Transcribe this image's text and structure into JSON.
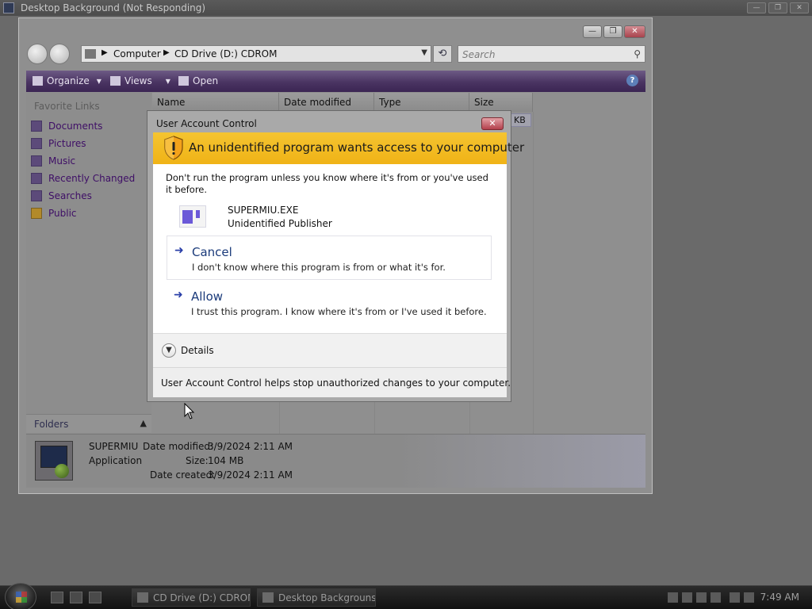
{
  "hung_window": {
    "title": "Desktop Background (Not Responding)",
    "buttons": [
      "—",
      "❐",
      "✕"
    ]
  },
  "explorer": {
    "title_buttons": [
      "—",
      "❐",
      "✕"
    ],
    "address": {
      "crumbs": [
        "Computer",
        "CD Drive (D:) CDROM"
      ]
    },
    "search_placeholder": "Search",
    "toolbar": {
      "organize": "Organize",
      "views": "Views",
      "open": "Open",
      "help": "?"
    },
    "favorites": {
      "title": "Favorite Links",
      "items": [
        "Documents",
        "Pictures",
        "Music",
        "Recently Changed",
        "Searches",
        "Public"
      ]
    },
    "folders_label": "Folders",
    "columns": [
      "Name",
      "Date modified",
      "Type",
      "Size"
    ],
    "size_cell": "KB",
    "details": {
      "name": "SUPERMIU",
      "type": "Application",
      "date_modified_label": "Date modified:",
      "date_modified": "3/9/2024 2:11 AM",
      "size_label": "Size:",
      "size": "104 MB",
      "date_created_label": "Date created:",
      "date_created": "3/9/2024 2:11 AM"
    }
  },
  "uac": {
    "title": "User Account Control",
    "close": "✕",
    "heading": "An unidentified program wants access to your computer",
    "warning": "Don't run the program unless you know where it's from or you've used it before.",
    "program_name": "SUPERMIU.EXE",
    "publisher": "Unidentified Publisher",
    "cancel": {
      "title": "Cancel",
      "description": "I don't know where this program is from or what it's for."
    },
    "allow": {
      "title": "Allow",
      "description": "I trust this program. I know where it's from or I've used it before."
    },
    "details_label": "Details",
    "footer": "User Account Control helps stop unauthorized changes to your computer."
  },
  "taskbar": {
    "buttons": [
      "CD Drive (D:) CDROM",
      "Desktop Backgrouns..."
    ],
    "clock": "7:49 AM"
  }
}
